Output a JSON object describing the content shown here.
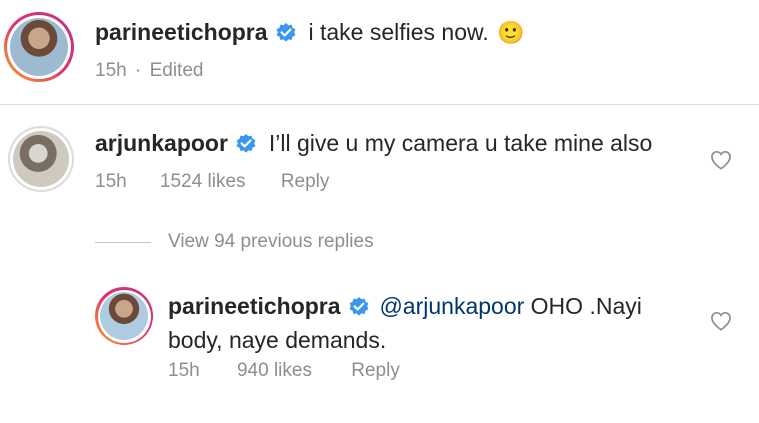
{
  "caption": {
    "username": "parineetichopra",
    "text": "i take selfies now.",
    "emoji": "🙂",
    "time": "15h",
    "separator": "·",
    "edited": "Edited"
  },
  "comment": {
    "username": "arjunkapoor",
    "text": "I’ll give u my camera u take mine also",
    "time": "15h",
    "likes": "1524 likes",
    "reply_label": "Reply"
  },
  "view_replies": "View 94 previous replies",
  "reply": {
    "username": "parineetichopra",
    "mention": "@arjunkapoor",
    "text": " OHO .Nayi body, naye demands.",
    "time": "15h",
    "likes": "940 likes",
    "reply_label": "Reply"
  },
  "colors": {
    "verified": "#3897f0",
    "meta": "#8e8e8e",
    "mention": "#00376b"
  },
  "icons": {
    "verified": "verified-badge-icon",
    "like": "heart-outline-icon"
  }
}
